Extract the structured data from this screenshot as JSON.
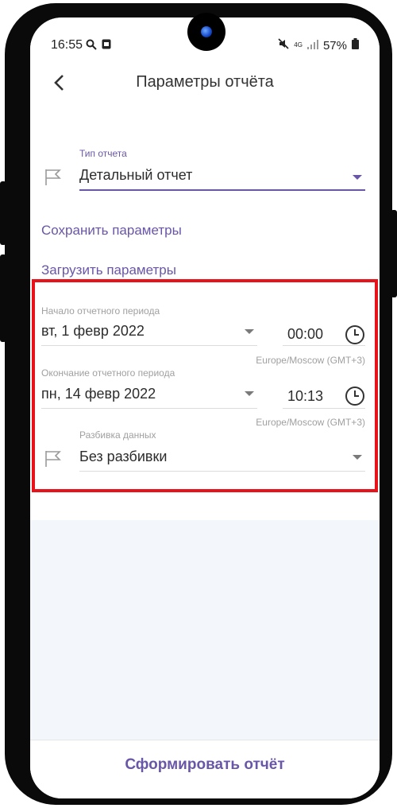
{
  "status_bar": {
    "time": "16:55",
    "left_icons": [
      "search-icon",
      "image-icon"
    ],
    "right_text": "57%",
    "network": "4G"
  },
  "header": {
    "title": "Параметры отчёта",
    "back_icon": "‹"
  },
  "report_type": {
    "label": "Тип отчета",
    "value": "Детальный отчет"
  },
  "links": {
    "save": "Сохранить параметры",
    "load": "Загрузить параметры"
  },
  "period_start": {
    "label": "Начало отчетного периода",
    "date": "вт, 1 февр 2022",
    "time": "00:00",
    "timezone": "Europe/Moscow (GMT+3)"
  },
  "period_end": {
    "label": "Окончание отчетного периода",
    "date": "пн, 14 февр 2022",
    "time": "10:13",
    "timezone": "Europe/Moscow (GMT+3)"
  },
  "breakdown": {
    "label": "Разбивка данных",
    "value": "Без разбивки"
  },
  "footer": {
    "action": "Сформировать отчёт"
  },
  "colors": {
    "accent": "#6a56a8",
    "highlight": "#e8121a"
  }
}
